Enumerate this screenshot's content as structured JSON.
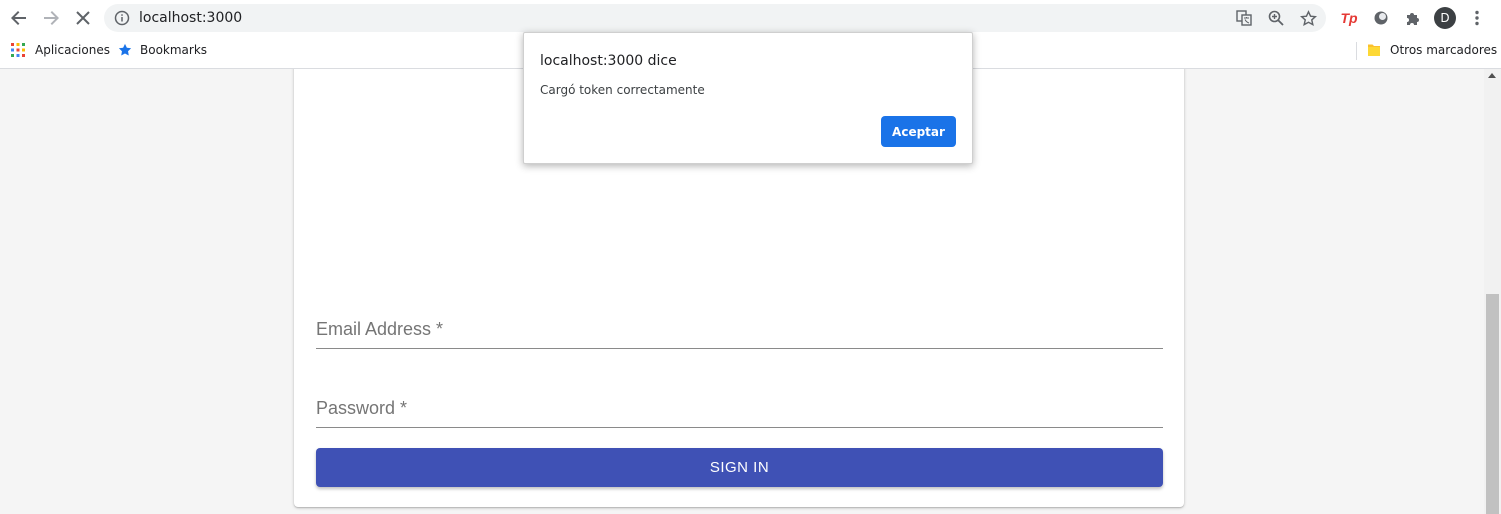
{
  "browser": {
    "url": "localhost:3000",
    "bookmarks": {
      "apps_label": "Aplicaciones",
      "bookmarks_label": "Bookmarks",
      "other_label": "Otros marcadores"
    },
    "profile_initial": "D",
    "extension_label": "Tp",
    "icons": [
      "back-arrow-icon",
      "forward-arrow-icon",
      "stop-loading-icon",
      "info-icon",
      "translate-icon",
      "zoom-icon",
      "star-icon",
      "extensions-puzzle-icon",
      "menu-kebab-icon"
    ],
    "colors": {
      "accent": "#1a73e8",
      "toolbar": "#ffffff",
      "omnibox": "#f1f3f4"
    }
  },
  "form": {
    "email_label": "Email Address *",
    "password_label": "Password *",
    "signin_label": "SIGN IN",
    "button_color": "#3f51b5"
  },
  "dialog": {
    "title": "localhost:3000 dice",
    "message": "Cargó token correctamente",
    "button_label": "Aceptar"
  }
}
